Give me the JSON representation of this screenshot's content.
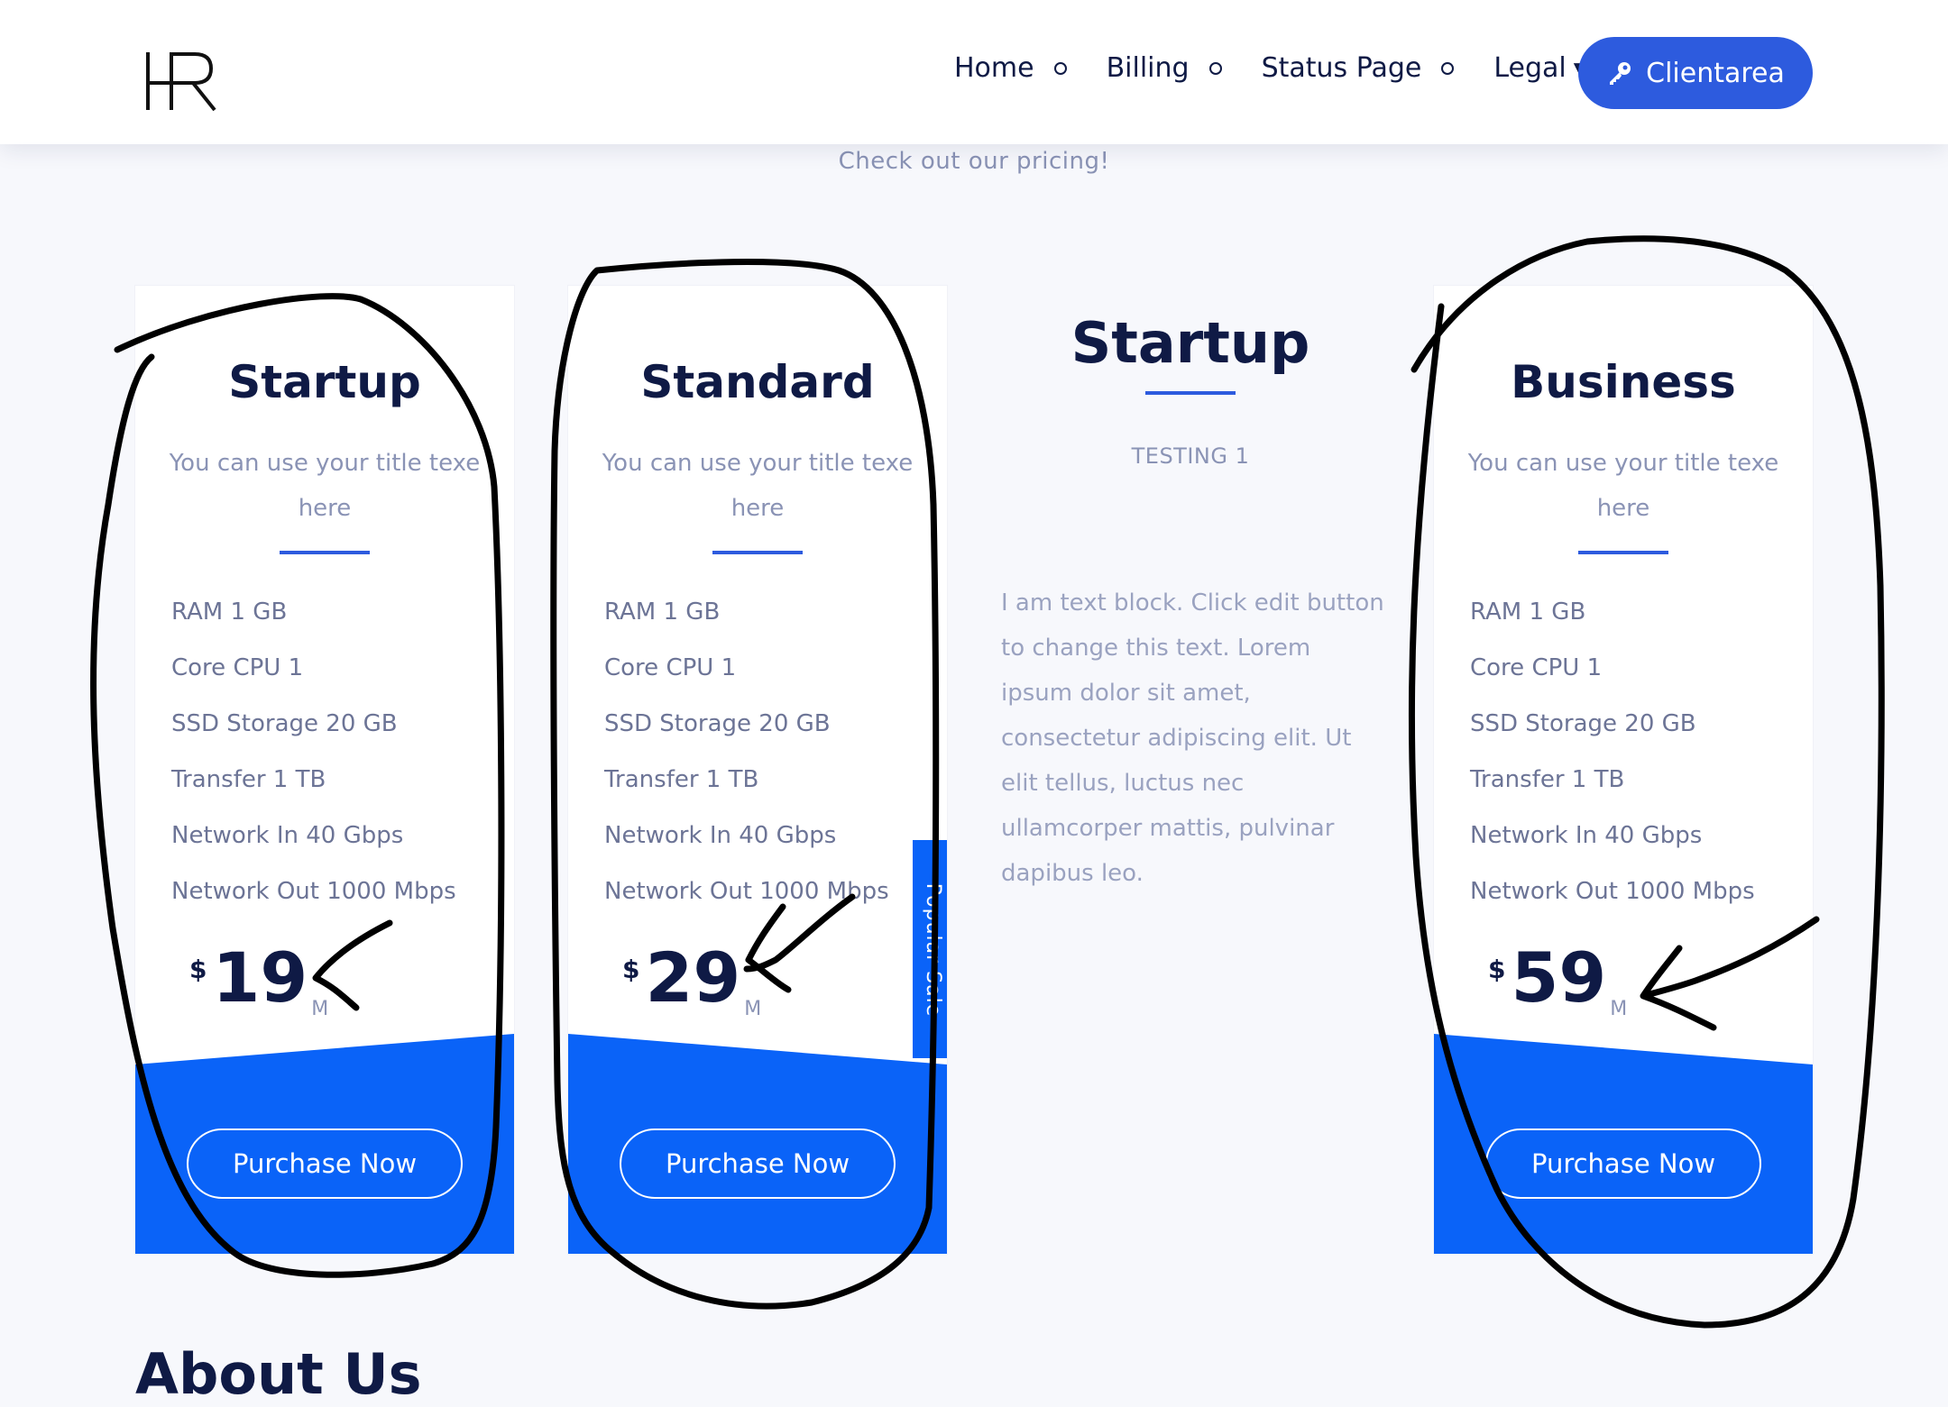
{
  "brand": {
    "logo_text": "HR"
  },
  "nav": {
    "items": [
      {
        "label": "Home"
      },
      {
        "label": "Billing"
      },
      {
        "label": "Status Page"
      },
      {
        "label": "Legal"
      }
    ],
    "client_button": "Clientarea"
  },
  "pricing": {
    "subtitle": "Check out our pricing!",
    "cards": [
      {
        "title": "Startup",
        "description": "You can use your title texe here",
        "features": [
          "RAM 1 GB",
          "Core CPU 1",
          "SSD Storage 20 GB",
          "Transfer 1 TB",
          "Network In 40 Gbps",
          "Network Out 1000 Mbps"
        ],
        "currency": "$",
        "price": "19",
        "period": "M",
        "button": "Purchase Now"
      },
      {
        "title": "Standard",
        "description": "You can use your title texe here",
        "features": [
          "RAM 1 GB",
          "Core CPU 1",
          "SSD Storage 20 GB",
          "Transfer 1 TB",
          "Network In 40 Gbps",
          "Network Out 1000 Mbps"
        ],
        "currency": "$",
        "price": "29",
        "period": "M",
        "button": "Purchase Now",
        "ribbon": "Popular Sale"
      },
      {
        "title": "Business",
        "description": "You can use your title texe here",
        "features": [
          "RAM 1 GB",
          "Core CPU 1",
          "SSD Storage 20 GB",
          "Transfer 1 TB",
          "Network In 40 Gbps",
          "Network Out 1000 Mbps"
        ],
        "currency": "$",
        "price": "59",
        "period": "M",
        "button": "Purchase Now"
      }
    ]
  },
  "text_block": {
    "title": "Startup",
    "subtitle": "TESTING 1",
    "body": "I am text block. Click edit button to change this text. Lorem ipsum dolor sit amet, consectetur adipiscing elit. Ut elit tellus, luctus nec ullamcorper mattis, pulvinar dapibus leo."
  },
  "about": {
    "title": "About Us"
  },
  "colors": {
    "accent": "#2d5bde",
    "card_footer": "#0a63f8",
    "heading": "#0f1a45",
    "muted": "#8a93b5"
  },
  "icons": {
    "client_button": "key-icon",
    "legal_dropdown": "caret-down-icon"
  }
}
